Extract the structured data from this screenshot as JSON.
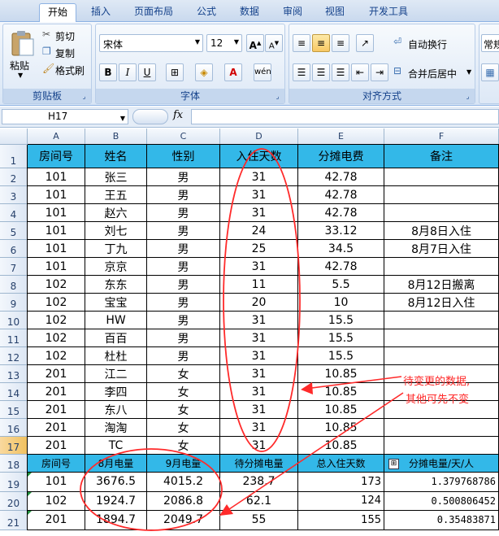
{
  "ribbon": {
    "tabs": [
      "开始",
      "插入",
      "页面布局",
      "公式",
      "数据",
      "审阅",
      "视图",
      "开发工具"
    ],
    "clipboard": {
      "paste": "粘贴",
      "cut": "剪切",
      "copy": "复制",
      "format_painter": "格式刷",
      "label": "剪贴板"
    },
    "font": {
      "name": "宋体",
      "size": "12",
      "bold": "B",
      "italic": "I",
      "underline": "U",
      "label": "字体"
    },
    "alignment": {
      "wrap": "自动换行",
      "merge": "合并后居中",
      "label": "对齐方式"
    },
    "number": {
      "format": "常规"
    }
  },
  "formula_bar": {
    "cell_ref": "H17",
    "fx": "fx",
    "content": ""
  },
  "columns": [
    "A",
    "B",
    "C",
    "D",
    "E",
    "F"
  ],
  "rows": [
    "1",
    "2",
    "3",
    "4",
    "5",
    "6",
    "7",
    "8",
    "9",
    "10",
    "11",
    "12",
    "13",
    "14",
    "15",
    "16",
    "17",
    "18",
    "19",
    "20",
    "21"
  ],
  "table1": {
    "headers": [
      "房间号",
      "姓名",
      "性别",
      "入住天数",
      "分摊电费",
      "备注"
    ],
    "rows": [
      [
        "101",
        "张三",
        "男",
        "31",
        "42.78",
        ""
      ],
      [
        "101",
        "王五",
        "男",
        "31",
        "42.78",
        ""
      ],
      [
        "101",
        "赵六",
        "男",
        "31",
        "42.78",
        ""
      ],
      [
        "101",
        "刘七",
        "男",
        "24",
        "33.12",
        "8月8日入住"
      ],
      [
        "101",
        "丁九",
        "男",
        "25",
        "34.5",
        "8月7日入住"
      ],
      [
        "101",
        "京京",
        "男",
        "31",
        "42.78",
        ""
      ],
      [
        "102",
        "东东",
        "男",
        "11",
        "5.5",
        "8月12日搬离"
      ],
      [
        "102",
        "宝宝",
        "男",
        "20",
        "10",
        "8月12日入住"
      ],
      [
        "102",
        "HW",
        "男",
        "31",
        "15.5",
        ""
      ],
      [
        "102",
        "百百",
        "男",
        "31",
        "15.5",
        ""
      ],
      [
        "102",
        "杜杜",
        "男",
        "31",
        "15.5",
        ""
      ],
      [
        "201",
        "江二",
        "女",
        "31",
        "10.85",
        ""
      ],
      [
        "201",
        "李四",
        "女",
        "31",
        "10.85",
        ""
      ],
      [
        "201",
        "东八",
        "女",
        "31",
        "10.85",
        ""
      ],
      [
        "201",
        "淘淘",
        "女",
        "31",
        "10.85",
        ""
      ],
      [
        "201",
        "TC",
        "女",
        "31",
        "10.85",
        ""
      ]
    ]
  },
  "table2": {
    "headers": [
      "房间号",
      "8月电量",
      "9月电量",
      "待分摊电量",
      "总入住天数",
      "分摊电量/天/人"
    ],
    "rows": [
      [
        "101",
        "3676.5",
        "4015.2",
        "238.7",
        "173",
        "1.379768786"
      ],
      [
        "102",
        "1924.7",
        "2086.8",
        "62.1",
        "124",
        "0.500806452"
      ],
      [
        "201",
        "1894.7",
        "2049.7",
        "55",
        "155",
        "0.35483871"
      ]
    ]
  },
  "annotation": {
    "line1": "待变更的数据,",
    "line2": "其他可先不变"
  },
  "colors": {
    "header_fill": "#33b8e8",
    "annotation": "#ff2a2a",
    "selection": "#f1c15f"
  }
}
